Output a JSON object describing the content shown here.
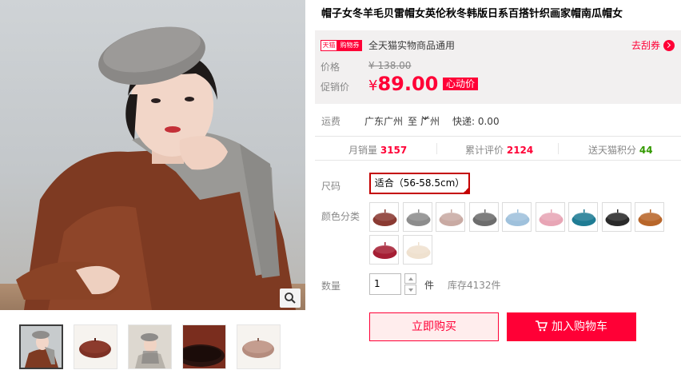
{
  "title": "帽子女冬羊毛贝雷帽女英伦秋冬韩版日系百搭针织画家帽南瓜帽女",
  "promo": {
    "tag_tmall": "天猫",
    "tag_coupon": "购物券",
    "text": "全天猫实物商品通用",
    "coupon_link": "去刮券"
  },
  "price": {
    "original_label": "价格",
    "original_value": "¥ 138.00",
    "sale_label": "促销价",
    "currency": "¥",
    "sale_value": "89.00",
    "activity_tag": "心动价"
  },
  "shipping": {
    "label": "运费",
    "from": "广东广州",
    "to_word": "至",
    "to": "广州",
    "express": "快递: 0.00"
  },
  "stats": {
    "monthly_sales_label": "月销量",
    "monthly_sales": "3157",
    "reviews_label": "累计评价",
    "reviews": "2124",
    "points_label": "送天猫积分",
    "points": "44"
  },
  "options": {
    "size_label": "尺码",
    "size_value": "适合（56-58.5cm）",
    "color_label": "颜色分类",
    "swatches": [
      {
        "color": "#8a3a32"
      },
      {
        "color": "#8d8d8d"
      },
      {
        "color": "#c9aaa3"
      },
      {
        "color": "#6d6d6d"
      },
      {
        "color": "#9fc1dc"
      },
      {
        "color": "#e8a5b5"
      },
      {
        "color": "#1f7c94"
      },
      {
        "color": "#2a2a2a"
      },
      {
        "color": "#b8662a"
      },
      {
        "color": "#a51e34"
      },
      {
        "color": "#efe1cf"
      }
    ]
  },
  "quantity": {
    "label": "数量",
    "value": "1",
    "unit": "件",
    "stock": "库存4132件"
  },
  "actions": {
    "buy_now": "立即购买",
    "add_to_cart": "加入购物车"
  },
  "colors": {
    "accent": "#ff0036",
    "selected_border": "#c40000"
  }
}
